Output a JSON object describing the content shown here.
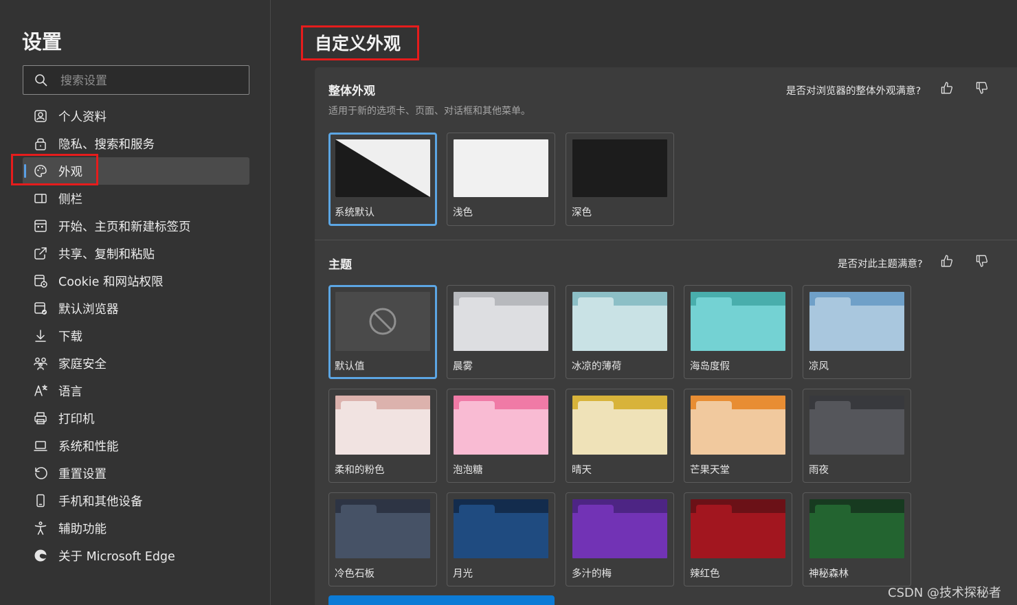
{
  "sidebar": {
    "title": "设置",
    "search_placeholder": "搜索设置",
    "items": [
      {
        "label": "个人资料",
        "icon": "profile-icon"
      },
      {
        "label": "隐私、搜索和服务",
        "icon": "lock-icon"
      },
      {
        "label": "外观",
        "icon": "palette-icon",
        "active": true
      },
      {
        "label": "侧栏",
        "icon": "sidebar-icon"
      },
      {
        "label": "开始、主页和新建标签页",
        "icon": "home-grid-icon"
      },
      {
        "label": "共享、复制和粘贴",
        "icon": "share-icon"
      },
      {
        "label": "Cookie 和网站权限",
        "icon": "cookie-icon"
      },
      {
        "label": "默认浏览器",
        "icon": "default-browser-icon"
      },
      {
        "label": "下载",
        "icon": "download-icon"
      },
      {
        "label": "家庭安全",
        "icon": "family-icon"
      },
      {
        "label": "语言",
        "icon": "language-icon"
      },
      {
        "label": "打印机",
        "icon": "printer-icon"
      },
      {
        "label": "系统和性能",
        "icon": "laptop-icon"
      },
      {
        "label": "重置设置",
        "icon": "reset-icon"
      },
      {
        "label": "手机和其他设备",
        "icon": "phone-icon"
      },
      {
        "label": "辅助功能",
        "icon": "accessibility-icon"
      },
      {
        "label": "关于 Microsoft Edge",
        "icon": "edge-logo-icon"
      }
    ]
  },
  "main": {
    "page_title": "自定义外观",
    "overall": {
      "title": "整体外观",
      "subtitle": "适用于新的选项卡、页面、对话框和其他菜单。",
      "feedback": "是否对浏览器的整体外观满意?",
      "options": [
        {
          "label": "系统默认",
          "selected": true
        },
        {
          "label": "浅色",
          "selected": false
        },
        {
          "label": "深色",
          "selected": false
        }
      ]
    },
    "themes": {
      "title": "主题",
      "feedback": "是否对此主题满意?",
      "items": [
        {
          "label": "默认值",
          "selected": true,
          "default": true
        },
        {
          "label": "晨雾",
          "top": "#b7b9bd",
          "tab": "#dddee1",
          "body": "#dddee1"
        },
        {
          "label": "冰凉的薄荷",
          "top": "#8cbfc6",
          "tab": "#c9e2e5",
          "body": "#c9e2e5"
        },
        {
          "label": "海岛度假",
          "top": "#49aeac",
          "tab": "#74d2d3",
          "body": "#74d2d3"
        },
        {
          "label": "凉风",
          "top": "#6fa0c8",
          "tab": "#a9c7de",
          "body": "#a9c7de"
        },
        {
          "label": "柔和的粉色",
          "top": "#dcb2ad",
          "tab": "#f1e3e1",
          "body": "#f1e3e1"
        },
        {
          "label": "泡泡糖",
          "top": "#f07aa6",
          "tab": "#f9bbd3",
          "body": "#f9bbd3"
        },
        {
          "label": "晴天",
          "top": "#d8b33a",
          "tab": "#efe2b8",
          "body": "#efe2b8"
        },
        {
          "label": "芒果天堂",
          "top": "#e88d33",
          "tab": "#f1c99e",
          "body": "#f1c99e"
        },
        {
          "label": "雨夜",
          "top": "#38393d",
          "tab": "#55565b",
          "body": "#55565b"
        },
        {
          "label": "冷色石板",
          "top": "#2d3444",
          "tab": "#465266",
          "body": "#465266"
        },
        {
          "label": "月光",
          "top": "#132c4d",
          "tab": "#1f4b80",
          "body": "#1f4b80"
        },
        {
          "label": "多汁的梅",
          "top": "#4d2584",
          "tab": "#7233b5",
          "body": "#7233b5"
        },
        {
          "label": "辣红色",
          "top": "#6b1117",
          "tab": "#a2161f",
          "body": "#a2161f"
        },
        {
          "label": "神秘森林",
          "top": "#173a20",
          "tab": "#236430",
          "body": "#236430"
        }
      ]
    }
  },
  "watermark": "CSDN @技术探秘者",
  "colors": {
    "accent": "#5ca6e4",
    "highlight": "#e61c1c",
    "primary_button": "#0c7bd6"
  }
}
